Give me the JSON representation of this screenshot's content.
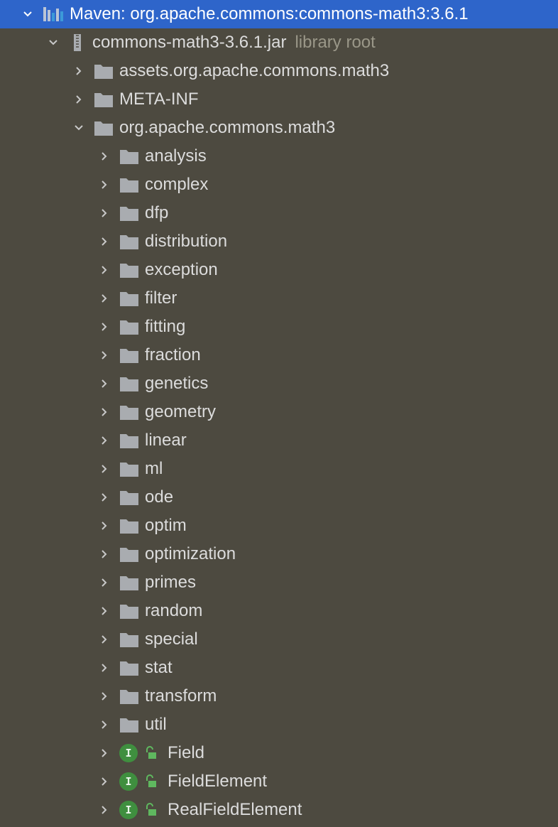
{
  "tree": {
    "root": {
      "label": "Maven: org.apache.commons:commons-math3:3.6.1",
      "expanded": true,
      "icon": "maven-library-icon"
    },
    "jar": {
      "label": "commons-math3-3.6.1.jar",
      "hint": "library root",
      "expanded": true,
      "icon": "jar-icon"
    },
    "jar_children": [
      {
        "label": "assets.org.apache.commons.math3",
        "expanded": false,
        "icon": "folder-icon"
      },
      {
        "label": "META-INF",
        "expanded": false,
        "icon": "folder-icon"
      },
      {
        "label": "org.apache.commons.math3",
        "expanded": true,
        "icon": "folder-icon"
      }
    ],
    "packages": [
      "analysis",
      "complex",
      "dfp",
      "distribution",
      "exception",
      "filter",
      "fitting",
      "fraction",
      "genetics",
      "geometry",
      "linear",
      "ml",
      "ode",
      "optim",
      "optimization",
      "primes",
      "random",
      "special",
      "stat",
      "transform",
      "util"
    ],
    "interfaces": [
      {
        "label": "Field",
        "badge": "I"
      },
      {
        "label": "FieldElement",
        "badge": "I"
      },
      {
        "label": "RealFieldElement",
        "badge": "I"
      }
    ]
  },
  "colors": {
    "background": "#4d4a40",
    "selection": "#2e65ca",
    "text": "#dcdcdc",
    "hint": "#9a9788",
    "folder": "#a9acb0",
    "interface_badge": "#3f8f3f"
  }
}
